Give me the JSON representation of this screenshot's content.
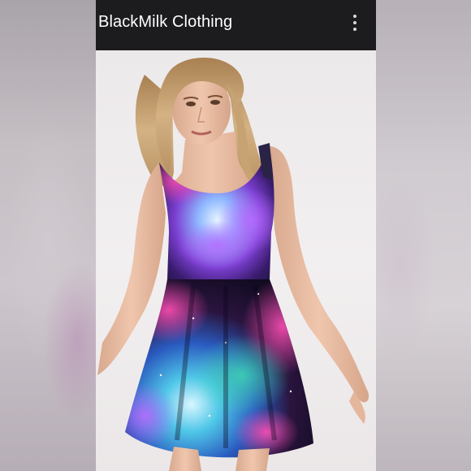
{
  "app_bar": {
    "title": "BlackMilk Clothing",
    "menu_icon": "more-vert-icon"
  },
  "colors": {
    "app_bar_bg": "#1c1b1e",
    "app_bar_text": "#ffffff",
    "photo_bg": "#efeced"
  }
}
